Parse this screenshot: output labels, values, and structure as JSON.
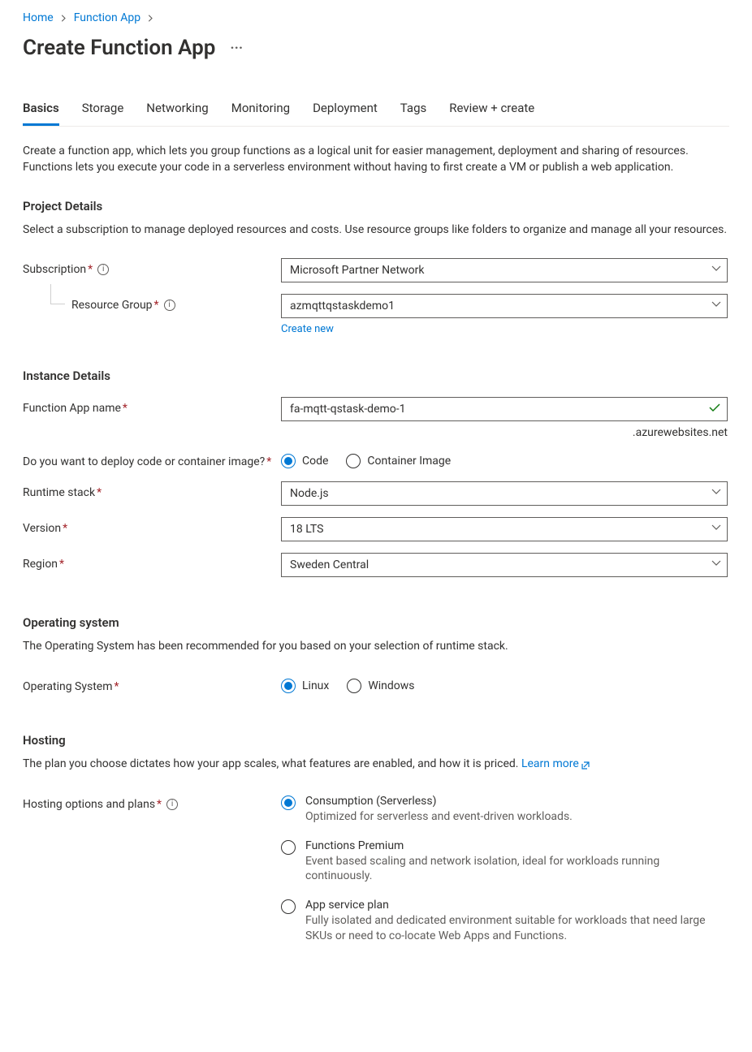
{
  "breadcrumb": {
    "home": "Home",
    "function_app": "Function App"
  },
  "page_title": "Create Function App",
  "tabs": [
    {
      "label": "Basics",
      "active": true
    },
    {
      "label": "Storage",
      "active": false
    },
    {
      "label": "Networking",
      "active": false
    },
    {
      "label": "Monitoring",
      "active": false
    },
    {
      "label": "Deployment",
      "active": false
    },
    {
      "label": "Tags",
      "active": false
    },
    {
      "label": "Review + create",
      "active": false
    }
  ],
  "intro": "Create a function app, which lets you group functions as a logical unit for easier management, deployment and sharing of resources. Functions lets you execute your code in a serverless environment without having to first create a VM or publish a web application.",
  "sections": {
    "project": {
      "title": "Project Details",
      "desc": "Select a subscription to manage deployed resources and costs. Use resource groups like folders to organize and manage all your resources.",
      "subscription_label": "Subscription",
      "subscription_value": "Microsoft Partner Network",
      "rg_label": "Resource Group",
      "rg_value": "azmqttqstaskdemo1",
      "create_new": "Create new"
    },
    "instance": {
      "title": "Instance Details",
      "name_label": "Function App name",
      "name_value": "fa-mqtt-qstask-demo-1",
      "name_suffix": ".azurewebsites.net",
      "deploy_label": "Do you want to deploy code or container image?",
      "deploy_opts": {
        "code": "Code",
        "container": "Container Image"
      },
      "runtime_label": "Runtime stack",
      "runtime_value": "Node.js",
      "version_label": "Version",
      "version_value": "18 LTS",
      "region_label": "Region",
      "region_value": "Sweden Central"
    },
    "os": {
      "title": "Operating system",
      "desc": "The Operating System has been recommended for you based on your selection of runtime stack.",
      "label": "Operating System",
      "opts": {
        "linux": "Linux",
        "windows": "Windows"
      }
    },
    "hosting": {
      "title": "Hosting",
      "desc": "The plan you choose dictates how your app scales, what features are enabled, and how it is priced. ",
      "learn_more": "Learn more",
      "label": "Hosting options and plans",
      "plans": [
        {
          "title": "Consumption (Serverless)",
          "desc": "Optimized for serverless and event-driven workloads.",
          "selected": true
        },
        {
          "title": "Functions Premium",
          "desc": "Event based scaling and network isolation, ideal for workloads running continuously.",
          "selected": false
        },
        {
          "title": "App service plan",
          "desc": "Fully isolated and dedicated environment suitable for workloads that need large SKUs or need to co-locate Web Apps and Functions.",
          "selected": false
        }
      ]
    }
  }
}
